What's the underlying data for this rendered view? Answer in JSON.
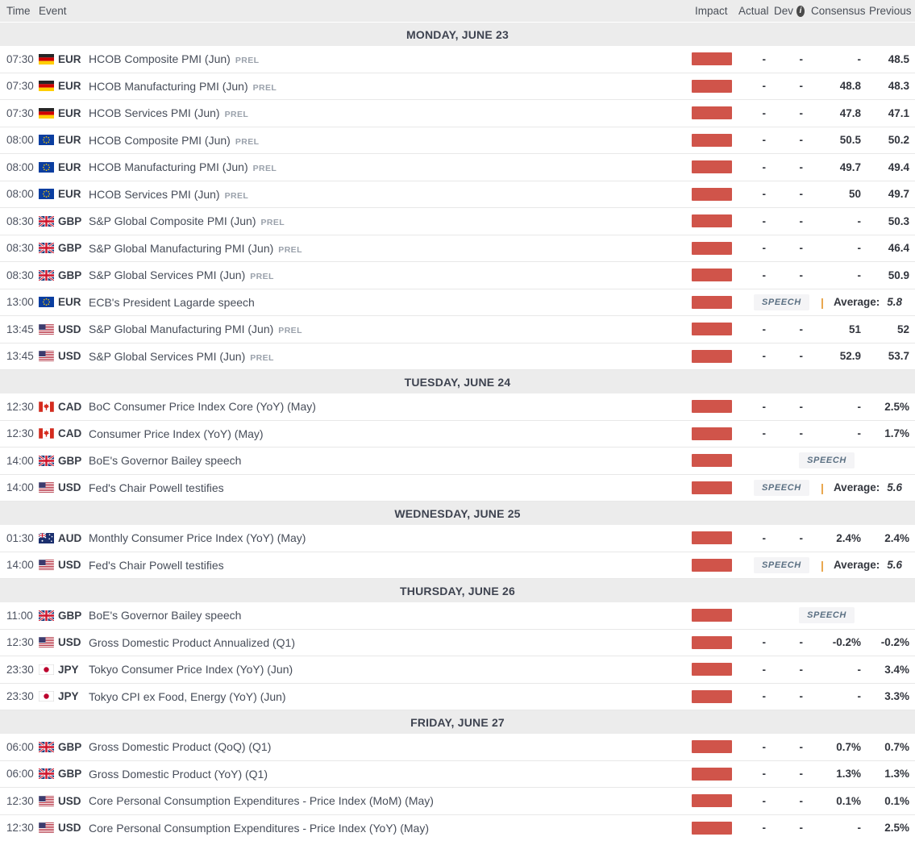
{
  "header": {
    "time": "Time",
    "event": "Event",
    "impact": "Impact",
    "actual": "Actual",
    "dev": "Dev",
    "info_icon": "i",
    "consensus": "Consensus",
    "previous": "Previous"
  },
  "labels": {
    "prel": "PREL",
    "speech": "SPEECH",
    "average": "Average:",
    "pipe": "|"
  },
  "colors": {
    "impact_high": "#d0544a",
    "pipe_accent": "#e79e3c",
    "speech_text": "#5b7083",
    "header_bg": "#ececec"
  },
  "sections": [
    {
      "label": "MONDAY, JUNE 23",
      "rows": [
        {
          "type": "normal",
          "time": "07:30",
          "flag": "germany",
          "currency": "EUR",
          "event": "HCOB Composite PMI (Jun)",
          "prel": true,
          "impact": "high",
          "actual": "-",
          "dev": "-",
          "consensus": "-",
          "previous": "48.5"
        },
        {
          "type": "normal",
          "time": "07:30",
          "flag": "germany",
          "currency": "EUR",
          "event": "HCOB Manufacturing PMI (Jun)",
          "prel": true,
          "impact": "high",
          "actual": "-",
          "dev": "-",
          "consensus": "48.8",
          "previous": "48.3"
        },
        {
          "type": "normal",
          "time": "07:30",
          "flag": "germany",
          "currency": "EUR",
          "event": "HCOB Services PMI (Jun)",
          "prel": true,
          "impact": "high",
          "actual": "-",
          "dev": "-",
          "consensus": "47.8",
          "previous": "47.1"
        },
        {
          "type": "normal",
          "time": "08:00",
          "flag": "eu",
          "currency": "EUR",
          "event": "HCOB Composite PMI (Jun)",
          "prel": true,
          "impact": "high",
          "actual": "-",
          "dev": "-",
          "consensus": "50.5",
          "previous": "50.2"
        },
        {
          "type": "normal",
          "time": "08:00",
          "flag": "eu",
          "currency": "EUR",
          "event": "HCOB Manufacturing PMI (Jun)",
          "prel": true,
          "impact": "high",
          "actual": "-",
          "dev": "-",
          "consensus": "49.7",
          "previous": "49.4"
        },
        {
          "type": "normal",
          "time": "08:00",
          "flag": "eu",
          "currency": "EUR",
          "event": "HCOB Services PMI (Jun)",
          "prel": true,
          "impact": "high",
          "actual": "-",
          "dev": "-",
          "consensus": "50",
          "previous": "49.7"
        },
        {
          "type": "normal",
          "time": "08:30",
          "flag": "uk",
          "currency": "GBP",
          "event": "S&P Global Composite PMI (Jun)",
          "prel": true,
          "impact": "high",
          "actual": "-",
          "dev": "-",
          "consensus": "-",
          "previous": "50.3"
        },
        {
          "type": "normal",
          "time": "08:30",
          "flag": "uk",
          "currency": "GBP",
          "event": "S&P Global Manufacturing PMI (Jun)",
          "prel": true,
          "impact": "high",
          "actual": "-",
          "dev": "-",
          "consensus": "-",
          "previous": "46.4"
        },
        {
          "type": "normal",
          "time": "08:30",
          "flag": "uk",
          "currency": "GBP",
          "event": "S&P Global Services PMI (Jun)",
          "prel": true,
          "impact": "high",
          "actual": "-",
          "dev": "-",
          "consensus": "-",
          "previous": "50.9"
        },
        {
          "type": "speech_avg",
          "time": "13:00",
          "flag": "eu",
          "currency": "EUR",
          "event": "ECB's President Lagarde speech",
          "prel": false,
          "impact": "high",
          "average": "5.8"
        },
        {
          "type": "normal",
          "time": "13:45",
          "flag": "us",
          "currency": "USD",
          "event": "S&P Global Manufacturing PMI (Jun)",
          "prel": true,
          "impact": "high",
          "actual": "-",
          "dev": "-",
          "consensus": "51",
          "previous": "52"
        },
        {
          "type": "normal",
          "time": "13:45",
          "flag": "us",
          "currency": "USD",
          "event": "S&P Global Services PMI (Jun)",
          "prel": true,
          "impact": "high",
          "actual": "-",
          "dev": "-",
          "consensus": "52.9",
          "previous": "53.7"
        }
      ]
    },
    {
      "label": "TUESDAY, JUNE 24",
      "rows": [
        {
          "type": "normal",
          "time": "12:30",
          "flag": "canada",
          "currency": "CAD",
          "event": "BoC Consumer Price Index Core (YoY) (May)",
          "prel": false,
          "impact": "high",
          "actual": "-",
          "dev": "-",
          "consensus": "-",
          "previous": "2.5%"
        },
        {
          "type": "normal",
          "time": "12:30",
          "flag": "canada",
          "currency": "CAD",
          "event": "Consumer Price Index (YoY) (May)",
          "prel": false,
          "impact": "high",
          "actual": "-",
          "dev": "-",
          "consensus": "-",
          "previous": "1.7%"
        },
        {
          "type": "speech",
          "time": "14:00",
          "flag": "uk",
          "currency": "GBP",
          "event": "BoE's Governor Bailey speech",
          "prel": false,
          "impact": "high"
        },
        {
          "type": "speech_avg",
          "time": "14:00",
          "flag": "us",
          "currency": "USD",
          "event": "Fed's Chair Powell testifies",
          "prel": false,
          "impact": "high",
          "average": "5.6"
        }
      ]
    },
    {
      "label": "WEDNESDAY, JUNE 25",
      "rows": [
        {
          "type": "normal",
          "time": "01:30",
          "flag": "australia",
          "currency": "AUD",
          "event": "Monthly Consumer Price Index (YoY) (May)",
          "prel": false,
          "impact": "high",
          "actual": "-",
          "dev": "-",
          "consensus": "2.4%",
          "previous": "2.4%"
        },
        {
          "type": "speech_avg",
          "time": "14:00",
          "flag": "us",
          "currency": "USD",
          "event": "Fed's Chair Powell testifies",
          "prel": false,
          "impact": "high",
          "average": "5.6"
        }
      ]
    },
    {
      "label": "THURSDAY, JUNE 26",
      "rows": [
        {
          "type": "speech",
          "time": "11:00",
          "flag": "uk",
          "currency": "GBP",
          "event": "BoE's Governor Bailey speech",
          "prel": false,
          "impact": "high"
        },
        {
          "type": "normal",
          "time": "12:30",
          "flag": "us",
          "currency": "USD",
          "event": "Gross Domestic Product Annualized (Q1)",
          "prel": false,
          "impact": "high",
          "actual": "-",
          "dev": "-",
          "consensus": "-0.2%",
          "previous": "-0.2%"
        },
        {
          "type": "normal",
          "time": "23:30",
          "flag": "japan",
          "currency": "JPY",
          "event": "Tokyo Consumer Price Index (YoY) (Jun)",
          "prel": false,
          "impact": "high",
          "actual": "-",
          "dev": "-",
          "consensus": "-",
          "previous": "3.4%"
        },
        {
          "type": "normal",
          "time": "23:30",
          "flag": "japan",
          "currency": "JPY",
          "event": "Tokyo CPI ex Food, Energy (YoY) (Jun)",
          "prel": false,
          "impact": "high",
          "actual": "-",
          "dev": "-",
          "consensus": "-",
          "previous": "3.3%"
        }
      ]
    },
    {
      "label": "FRIDAY, JUNE 27",
      "rows": [
        {
          "type": "normal",
          "time": "06:00",
          "flag": "uk",
          "currency": "GBP",
          "event": "Gross Domestic Product (QoQ) (Q1)",
          "prel": false,
          "impact": "high",
          "actual": "-",
          "dev": "-",
          "consensus": "0.7%",
          "previous": "0.7%"
        },
        {
          "type": "normal",
          "time": "06:00",
          "flag": "uk",
          "currency": "GBP",
          "event": "Gross Domestic Product (YoY) (Q1)",
          "prel": false,
          "impact": "high",
          "actual": "-",
          "dev": "-",
          "consensus": "1.3%",
          "previous": "1.3%"
        },
        {
          "type": "normal",
          "time": "12:30",
          "flag": "us",
          "currency": "USD",
          "event": "Core Personal Consumption Expenditures - Price Index (MoM) (May)",
          "prel": false,
          "impact": "high",
          "actual": "-",
          "dev": "-",
          "consensus": "0.1%",
          "previous": "0.1%"
        },
        {
          "type": "normal",
          "time": "12:30",
          "flag": "us",
          "currency": "USD",
          "event": "Core Personal Consumption Expenditures - Price Index (YoY) (May)",
          "prel": false,
          "impact": "high",
          "actual": "-",
          "dev": "-",
          "consensus": "-",
          "previous": "2.5%"
        }
      ]
    }
  ]
}
